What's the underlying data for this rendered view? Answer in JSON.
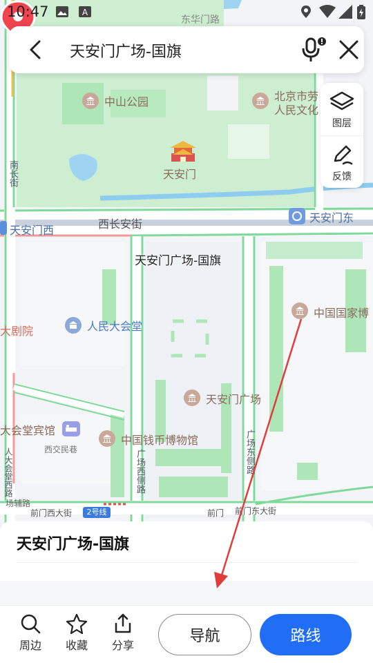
{
  "status_bar": {
    "time": "10:47"
  },
  "search": {
    "query": "天安门广场-国旗"
  },
  "map_tools": {
    "layers_label": "图层",
    "feedback_label": "反馈"
  },
  "map": {
    "pin_label": "天安门广场-国旗",
    "labels": {
      "donghuamen": "东华门路",
      "zhongshan_park": "中山公园",
      "beijing_culture": "北京市劳",
      "beijing_culture2": "人民文化",
      "nanchang": "南长街",
      "tiananmen": "天安门",
      "tiananmen_west": "天安门西",
      "xichangan": "西长安街",
      "tiananmen_east": "天安门东",
      "national_museum": "中国国家博",
      "theater": "大剧院",
      "great_hall": "人民大会堂",
      "square": "天安门广场",
      "guesthouse": "大会堂宾馆",
      "money_museum": "中国钱币博物馆",
      "xijiaominxiang": "西交民巷",
      "square_west_road": "广场西侧路",
      "square_east_road": "广场东侧路",
      "great_hall_west": "人大会堂西路",
      "auxiliary": "场辅路",
      "qianmen_west": "前门西大街",
      "qianmen": "前门",
      "qianmen_east": "前门东大街",
      "metro_line": "2号线"
    }
  },
  "place": {
    "title": "天安门广场-国旗"
  },
  "actions": {
    "nearby": "周边",
    "favorite": "收藏",
    "share": "分享",
    "navigate": "导航",
    "route": "路线"
  },
  "colors": {
    "route_blue": "#1f6ef5",
    "pin_red": "#f0444f",
    "park_green": "#c9efcc",
    "road_green": "#7fd99a",
    "arrow_red": "#e03c3c"
  }
}
